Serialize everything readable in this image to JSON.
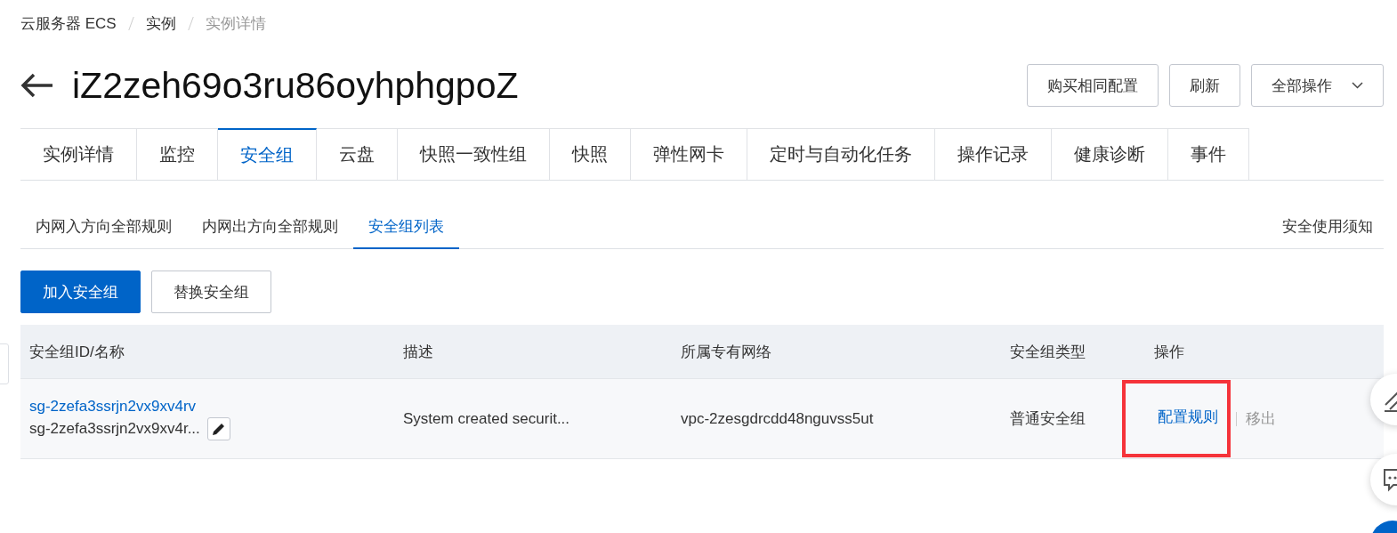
{
  "breadcrumb": [
    {
      "label": "云服务器 ECS",
      "current": false
    },
    {
      "label": "实例",
      "current": false
    },
    {
      "label": "实例详情",
      "current": true
    }
  ],
  "title": "iZ2zeh69o3ru86oyhphgpoZ",
  "header_buttons": [
    {
      "label": "购买相同配置",
      "kind": "plain"
    },
    {
      "label": "刷新",
      "kind": "plain"
    },
    {
      "label": "全部操作",
      "kind": "dropdown"
    }
  ],
  "tabs": [
    {
      "label": "实例详情",
      "selected": false
    },
    {
      "label": "监控",
      "selected": false
    },
    {
      "label": "安全组",
      "selected": true
    },
    {
      "label": "云盘",
      "selected": false
    },
    {
      "label": "快照一致性组",
      "selected": false
    },
    {
      "label": "快照",
      "selected": false
    },
    {
      "label": "弹性网卡",
      "selected": false
    },
    {
      "label": "定时与自动化任务",
      "selected": false
    },
    {
      "label": "操作记录",
      "selected": false
    },
    {
      "label": "健康诊断",
      "selected": false
    },
    {
      "label": "事件",
      "selected": false
    }
  ],
  "subtabs": [
    {
      "label": "内网入方向全部规则",
      "selected": false
    },
    {
      "label": "内网出方向全部规则",
      "selected": false
    },
    {
      "label": "安全组列表",
      "selected": true
    }
  ],
  "notice_link": "安全使用须知",
  "toolbar_buttons": [
    {
      "label": "加入安全组",
      "kind": "primary"
    },
    {
      "label": "替换安全组",
      "kind": "plain"
    }
  ],
  "table": {
    "columns": [
      "安全组ID/名称",
      "描述",
      "所属专有网络",
      "安全组类型",
      "操作"
    ],
    "rows": [
      {
        "id": "sg-2zefa3ssrjn2vx9xv4rv",
        "name": "sg-2zefa3ssrjn2vx9xv4r...",
        "description": "System created securit...",
        "vpc": "vpc-2zesgdrcdd48nguvss5ut",
        "type": "普通安全组",
        "actions": [
          {
            "label": "配置规则",
            "disabled": false,
            "highlighted": true
          },
          {
            "label": "移出",
            "disabled": true,
            "highlighted": false
          }
        ]
      }
    ]
  }
}
